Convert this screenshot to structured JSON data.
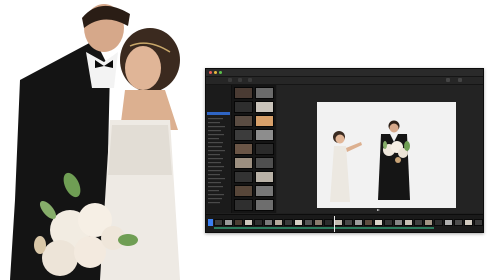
{
  "window": {
    "title": "",
    "toolbar_buttons": [
      "",
      "",
      ""
    ]
  },
  "library": {
    "items": [
      {
        "label": "",
        "selected": false
      },
      {
        "label": "",
        "selected": false
      },
      {
        "label": "",
        "selected": false
      },
      {
        "label": "",
        "selected": false
      },
      {
        "label": "",
        "selected": false
      },
      {
        "label": "",
        "selected": true
      }
    ]
  },
  "viewer": {
    "header": ""
  },
  "colors": {
    "accent": "#2f65c4",
    "window_bg": "#1f1f1f",
    "timeline_clip_selected": "#3c7ff0",
    "audio_track": "#2d7b5d"
  },
  "icons": [
    "close-icon",
    "minimize-icon",
    "maximize-icon",
    "play-icon"
  ]
}
